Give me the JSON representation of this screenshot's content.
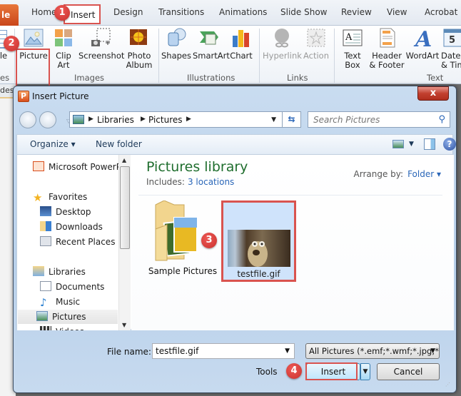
{
  "ribbon": {
    "file_tab": "le",
    "tabs": [
      "Home",
      "Insert",
      "Design",
      "Transitions",
      "Animations",
      "Slide Show",
      "Review",
      "View",
      "Acrobat"
    ],
    "active_tab": "Insert",
    "buttons": {
      "table_partial": "le",
      "picture": "Picture",
      "clip_art": "Clip Art",
      "screenshot": "Screenshot",
      "photo_album": "Photo Album",
      "shapes": "Shapes",
      "smartart": "SmartArt",
      "chart": "Chart",
      "hyperlink": "Hyperlink",
      "action": "Action",
      "text_box": "Text Box",
      "header_footer": "Header & Footer",
      "wordart": "WordArt",
      "date_time": "Date & Tim"
    },
    "groups": {
      "tables_partial": "es",
      "images": "Images",
      "illustrations": "Illustrations",
      "links": "Links",
      "text": "Text"
    }
  },
  "steps": [
    "1",
    "2",
    "3",
    "4"
  ],
  "background_partial": "des",
  "dialog": {
    "title": "Insert Picture",
    "app_icon_letter": "P",
    "close_glyph": "x",
    "address": {
      "crumbs": [
        "Libraries",
        "Pictures"
      ]
    },
    "search_placeholder": "Search Pictures",
    "toolbar": {
      "organize": "Organize ▾",
      "new_folder": "New folder"
    },
    "nav_pane": {
      "items": [
        {
          "label": "Microsoft PowerPo",
          "icon": "powerpoint-icon"
        },
        {
          "label": "Favorites",
          "icon": "star-icon"
        },
        {
          "label": "Desktop",
          "icon": "desktop-icon"
        },
        {
          "label": "Downloads",
          "icon": "downloads-icon"
        },
        {
          "label": "Recent Places",
          "icon": "recent-places-icon"
        },
        {
          "label": "Libraries",
          "icon": "libraries-icon"
        },
        {
          "label": "Documents",
          "icon": "documents-icon"
        },
        {
          "label": "Music",
          "icon": "music-icon"
        },
        {
          "label": "Pictures",
          "icon": "pictures-icon",
          "selected": true
        },
        {
          "label": "Videos",
          "icon": "videos-icon"
        }
      ]
    },
    "library": {
      "title": "Pictures library",
      "includes_label": "Includes:",
      "includes_link": "3 locations",
      "arrange_label": "Arrange by:",
      "arrange_value": "Folder ▾"
    },
    "files": [
      {
        "name": "Sample Pictures",
        "type": "folder"
      },
      {
        "name": "testfile.gif",
        "type": "image",
        "selected": true
      }
    ],
    "file_name_label": "File name:",
    "file_name_value": "testfile.gif",
    "file_type_value": "All Pictures (*.emf;*.wmf;*.jpg;*",
    "tools_label": "Tools",
    "insert_label": "Insert",
    "cancel_label": "Cancel"
  },
  "colors": {
    "highlight_red": "#d9534f",
    "library_title_green": "#1f6e2e",
    "link_blue": "#2a66b8",
    "selection_blue": "#cfe3fb"
  }
}
